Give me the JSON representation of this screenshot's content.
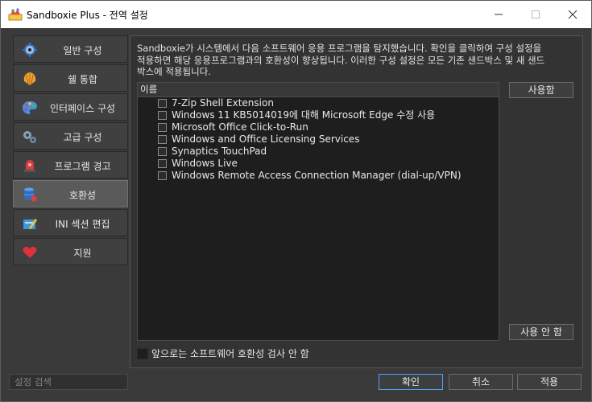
{
  "window": {
    "title": "Sandboxie Plus - 전역 설정",
    "controls": [
      "minimize-icon",
      "maximize-icon",
      "close-icon"
    ]
  },
  "sidebar": {
    "items": [
      {
        "label": "일반 구성",
        "icon": "gear-icon"
      },
      {
        "label": "쉘 통합",
        "icon": "shell-icon"
      },
      {
        "label": "인터페이스 구성",
        "icon": "palette-icon"
      },
      {
        "label": "고급 구성",
        "icon": "gears-icon"
      },
      {
        "label": "프로그램 경고",
        "icon": "alarm-icon"
      },
      {
        "label": "호환성",
        "icon": "database-icon",
        "active": true
      },
      {
        "label": "INI 섹션 편집",
        "icon": "edit-icon"
      },
      {
        "label": "지원",
        "icon": "heart-icon"
      }
    ]
  },
  "compat": {
    "description": "Sandboxie가 시스템에서 다음 소프트웨어 응용 프로그램을 탐지했습니다. 확인을 클릭하여 구성 설정을 적용하면 해당 응용프로그램과의 호환성이 향상됩니다. 이러한 구성 설정은 모든 기존 샌드박스 및 새 샌드박스에 적용됩니다.",
    "column_header": "이름",
    "items": [
      "7-Zip Shell Extension",
      "Windows 11 KB5014019에 대해 Microsoft Edge 수정 사용",
      "Microsoft Office Click-to-Run",
      "Windows and Office Licensing Services",
      "Synaptics TouchPad",
      "Windows Live",
      "Windows Remote Access Connection Manager (dial-up/VPN)"
    ],
    "enable_label": "사용함",
    "disable_label": "사용 안 함",
    "no_check_label": "앞으로는 소프트웨어 호환성 검사 안 함"
  },
  "footer": {
    "search_placeholder": "설정 검색",
    "ok_label": "확인",
    "cancel_label": "취소",
    "apply_label": "적용"
  },
  "colors": {
    "background": "#3a3a3a",
    "list_background": "#1e1e1e",
    "accent": "#4aa3ff"
  }
}
